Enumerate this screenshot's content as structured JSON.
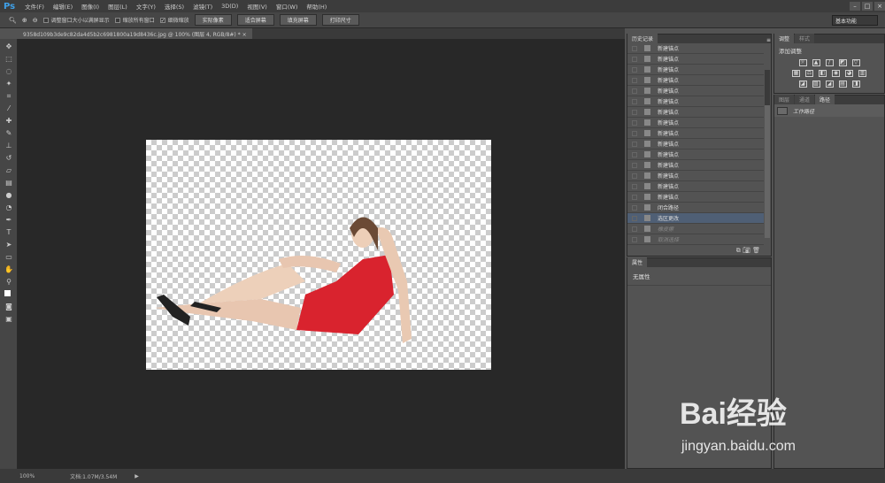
{
  "app": {
    "logo": "Ps"
  },
  "menu": [
    "文件(F)",
    "编辑(E)",
    "图像(I)",
    "图层(L)",
    "文字(Y)",
    "选择(S)",
    "滤镜(T)",
    "3D(D)",
    "视图(V)",
    "窗口(W)",
    "帮助(H)"
  ],
  "options": {
    "resize_windows": "调整窗口大小以满屏显示",
    "zoom_all": "缩放所有窗口",
    "scrubby_zoom": "细微缩放",
    "actual_pixels": "实际像素",
    "fit_screen": "适合屏幕",
    "fill_screen": "填充屏幕",
    "print_size": "打印尺寸",
    "workspace": "基本功能"
  },
  "document": {
    "tab": "9358d109b3de9c82da4d5b2c6981800a19d8436c.jpg @ 100% (图层 4, RGB/8#) *",
    "close": "×"
  },
  "history": {
    "title": "历史记录",
    "items": [
      {
        "label": "新建锚点"
      },
      {
        "label": "新建锚点"
      },
      {
        "label": "新建锚点"
      },
      {
        "label": "新建锚点"
      },
      {
        "label": "新建锚点"
      },
      {
        "label": "新建锚点"
      },
      {
        "label": "新建锚点"
      },
      {
        "label": "新建锚点"
      },
      {
        "label": "新建锚点"
      },
      {
        "label": "新建锚点"
      },
      {
        "label": "新建锚点"
      },
      {
        "label": "新建锚点"
      },
      {
        "label": "新建锚点"
      },
      {
        "label": "新建锚点"
      },
      {
        "label": "新建锚点"
      },
      {
        "label": "闭合路径"
      },
      {
        "label": "选区更改",
        "state": "selected"
      },
      {
        "label": "橡皮擦",
        "state": "undone"
      },
      {
        "label": "取消选择",
        "state": "undone"
      }
    ]
  },
  "properties": {
    "title": "属性",
    "value": "无属性"
  },
  "adjustments": {
    "tabs": [
      "调整",
      "样式"
    ],
    "title": "添加调整"
  },
  "paths": {
    "tabs": [
      "图层",
      "通道",
      "路径"
    ],
    "item": "工作路径"
  },
  "status": {
    "zoom": "100%",
    "doc": "文档:1.07M/3.54M"
  },
  "watermark": {
    "brand": "Bai经验",
    "url": "jingyan.baidu.com"
  }
}
